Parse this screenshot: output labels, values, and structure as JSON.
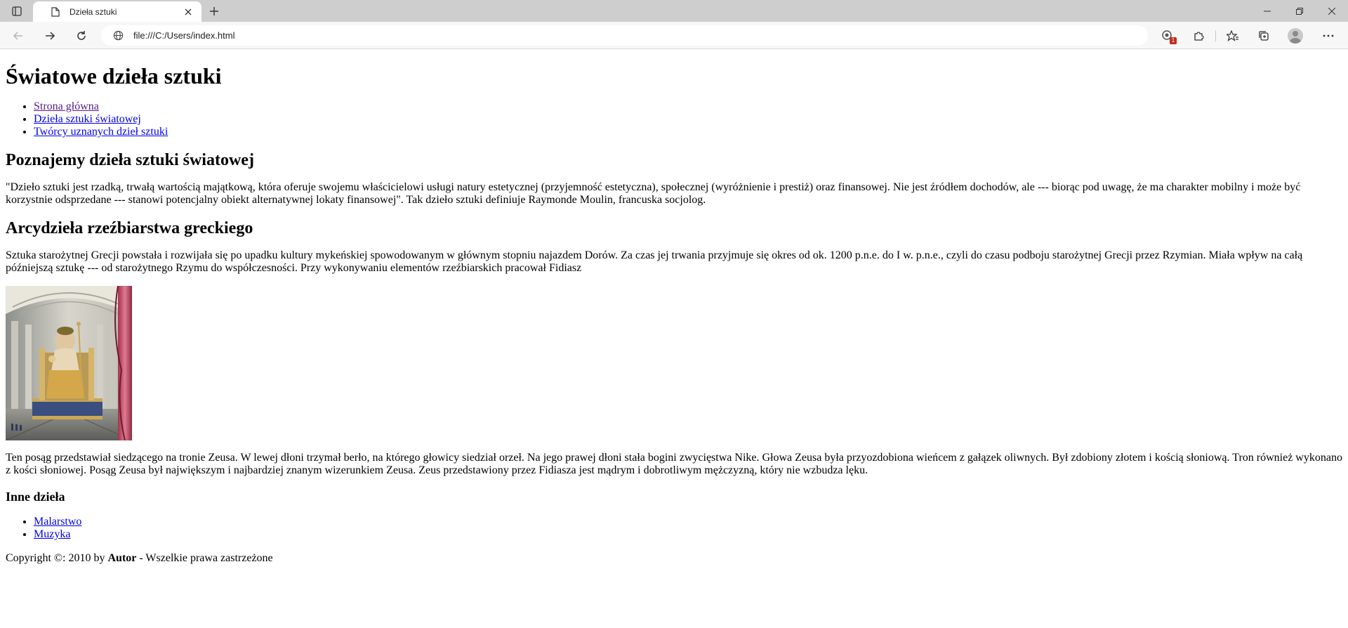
{
  "browser": {
    "tab_title": "Dzieła sztuki",
    "address_url": "file:///C:/Users/index.html",
    "extension_badge": "1"
  },
  "page": {
    "heading": "Światowe dzieła sztuki",
    "nav": [
      {
        "label": "Strona główna"
      },
      {
        "label": "Dzieła sztuki światowej"
      },
      {
        "label": "Twórcy uznanych dzieł sztuki"
      }
    ],
    "section1": {
      "title": "Poznajemy dzieła sztuki światowej",
      "text": "\"Dzieło sztuki jest rzadką, trwałą wartością majątkową, która oferuje swojemu właścicielowi usługi natury estetycznej (przyjemność estetyczna), społecznej (wyróżnienie i prestiż) oraz finansowej. Nie jest źródłem dochodów, ale --- biorąc pod uwagę, że ma charakter mobilny i może być korzystnie odsprzedane --- stanowi potencjalny obiekt alternatywnej lokaty finansowej\". Tak dzieło sztuki definiuje Raymonde Moulin, francuska socjolog."
    },
    "section2": {
      "title": "Arcydzieła rzeźbiarstwa greckiego",
      "text": "Sztuka starożytnej Grecji powstała i rozwijała się po upadku kultury mykeńskiej spowodowanym w głównym stopniu najazdem Dorów. Za czas jej trwania przyjmuje się okres od ok. 1200 p.n.e. do I w. p.n.e., czyli do czasu podboju starożytnej Grecji przez Rzymian. Miała wpływ na całą późniejszą sztukę --- od starożytnego Rzymu do współczesności. Przy wykonywaniu elementów rzeźbiarskich pracował Fidiasz",
      "image_caption": "Ten posąg przedstawiał siedzącego na tronie Zeusa. W lewej dłoni trzymał berło, na którego głowicy siedział orzeł. Na jego prawej dłoni stała bogini zwycięstwa Nike. Głowa Zeusa była przyozdobiona wieńcem z gałązek oliwnych. Był zdobiony złotem i kością słoniową. Tron również wykonano z kości słoniowej. Posąg Zeusa był największym i najbardziej znanym wizerunkiem Zeusa. Zeus przedstawiony przez Fidiasza jest mądrym i dobrotliwym mężczyzną, który nie wzbudza lęku."
    },
    "section3": {
      "title": "Inne dzieła",
      "links": [
        {
          "label": "Malarstwo"
        },
        {
          "label": "Muzyka"
        }
      ]
    },
    "footer": {
      "prefix": "Copyright ©: 2010 by ",
      "author": "Autor",
      "suffix": " - Wszelkie prawa zastrzeżone"
    }
  }
}
